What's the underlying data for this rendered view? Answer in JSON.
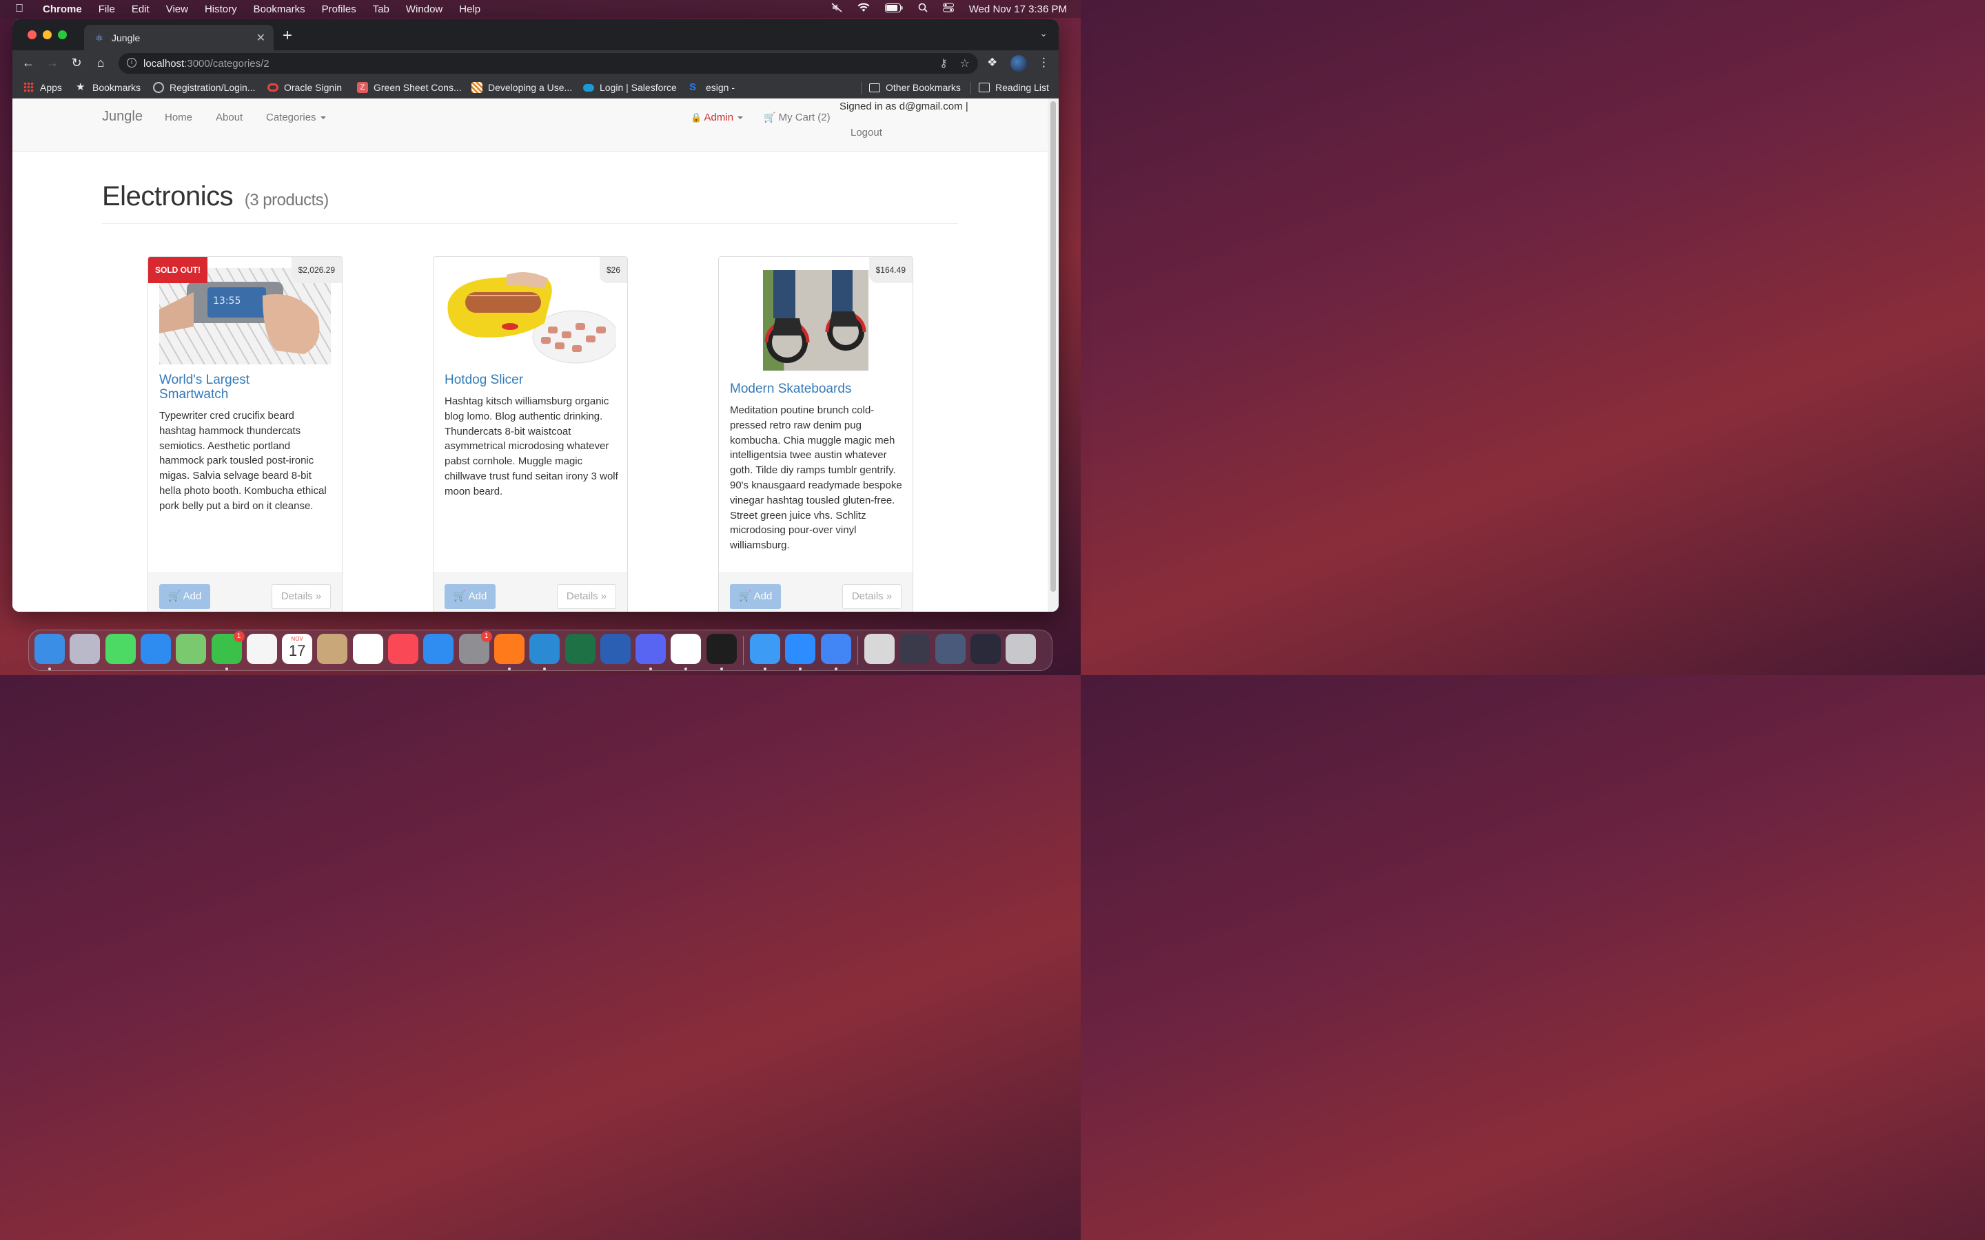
{
  "menubar": {
    "app_name": "Chrome",
    "items": [
      "File",
      "Edit",
      "View",
      "History",
      "Bookmarks",
      "Profiles",
      "Tab",
      "Window",
      "Help"
    ],
    "clock": "Wed Nov 17  3:36 PM"
  },
  "browser": {
    "tab_title": "Jungle",
    "url_host": "localhost",
    "url_path": ":3000/categories/2",
    "bookmarks": [
      {
        "label": "Apps",
        "icon": "apps-grid-icon",
        "color": "#e8453c"
      },
      {
        "label": "Bookmarks",
        "icon": "star-icon",
        "color": "#e8eaed"
      },
      {
        "label": "Registration/Login...",
        "icon": "globe-icon",
        "color": "#bdc1c6"
      },
      {
        "label": "Oracle Signin",
        "icon": "oracle-icon",
        "color": "#e8453c"
      },
      {
        "label": "Green Sheet Cons...",
        "icon": "z-icon",
        "color": "#e05d5d"
      },
      {
        "label": "Developing a Use...",
        "icon": "tiger-icon",
        "color": "#e08a2a"
      },
      {
        "label": "Login | Salesforce",
        "icon": "salesforce-icon",
        "color": "#1a9bd7"
      },
      {
        "label": "esign -",
        "icon": "s-icon",
        "color": "#2b7de9"
      }
    ],
    "other_bookmarks": "Other Bookmarks",
    "reading_list": "Reading List"
  },
  "navbar": {
    "brand": "Jungle",
    "home": "Home",
    "about": "About",
    "categories": "Categories",
    "admin": "Admin",
    "cart": "My Cart (2)",
    "signed_in": "Signed in as d@gmail.com |",
    "logout": "Logout"
  },
  "category": {
    "title": "Electronics",
    "count": "(3 products)"
  },
  "products": [
    {
      "name": "World's Largest Smartwatch",
      "price": "$2,026.29",
      "sold_out": "SOLD OUT!",
      "description": "Typewriter cred crucifix beard hashtag hammock thundercats semiotics. Aesthetic portland hammock park tousled post-ironic migas. Salvia selvage beard 8-bit hella photo booth. Kombucha ethical pork belly put a bird on it cleanse.",
      "add": "Add",
      "details": "Details »"
    },
    {
      "name": "Hotdog Slicer",
      "price": "$26",
      "description": "Hashtag kitsch williamsburg organic blog lomo. Blog authentic drinking. Thundercats 8-bit waistcoat asymmetrical microdosing whatever pabst cornhole. Muggle magic chillwave trust fund seitan irony 3 wolf moon beard.",
      "add": "Add",
      "details": "Details »"
    },
    {
      "name": "Modern Skateboards",
      "price": "$164.49",
      "description": "Meditation poutine brunch cold-pressed retro raw denim pug kombucha. Chia muggle magic meh intelligentsia twee austin whatever goth. Tilde diy ramps tumblr gentrify. 90's knausgaard readymade bespoke vinegar hashtag tousled gluten-free. Street green juice vhs. Schlitz microdosing pour-over vinyl williamsburg.",
      "add": "Add",
      "details": "Details »"
    }
  ],
  "dock": {
    "apps": [
      {
        "name": "finder-icon",
        "color": "#3a8ee6"
      },
      {
        "name": "launchpad-icon",
        "color": "#b9b9c9"
      },
      {
        "name": "messages-icon",
        "color": "#4cd964"
      },
      {
        "name": "mail-icon",
        "color": "#2e8bf0"
      },
      {
        "name": "maps-icon",
        "color": "#7bc96f"
      },
      {
        "name": "facetime-icon",
        "color": "#3bc14a"
      },
      {
        "name": "photos-icon",
        "color": "#f5f5f5"
      },
      {
        "name": "calendar-icon",
        "color": "#ffffff"
      },
      {
        "name": "contacts-icon",
        "color": "#c9a779"
      },
      {
        "name": "reminders-icon",
        "color": "#ffffff"
      },
      {
        "name": "music-icon",
        "color": "#fa4856"
      },
      {
        "name": "app-store-icon",
        "color": "#2f8cf0"
      },
      {
        "name": "system-preferences-icon",
        "color": "#8e8e93"
      },
      {
        "name": "firefox-icon",
        "color": "#ff7a1a"
      },
      {
        "name": "vscode-icon",
        "color": "#2a8ad4"
      },
      {
        "name": "excel-icon",
        "color": "#1e7145"
      },
      {
        "name": "word-icon",
        "color": "#2b5fb4"
      },
      {
        "name": "discord-icon",
        "color": "#5865f2"
      },
      {
        "name": "slack-icon",
        "color": "#ffffff"
      },
      {
        "name": "terminal-icon",
        "color": "#1e1e1e"
      },
      {
        "name": "safari-icon",
        "color": "#3b9bf5"
      },
      {
        "name": "zoom-icon",
        "color": "#2d8cff"
      },
      {
        "name": "chrome-icon",
        "color": "#4285f4"
      },
      {
        "name": "recent-window-1-icon",
        "color": "#d8d8d8"
      },
      {
        "name": "recent-window-2-icon",
        "color": "#3a3a4a"
      },
      {
        "name": "recent-window-3-icon",
        "color": "#4a5a7a"
      },
      {
        "name": "recent-window-4-icon",
        "color": "#2a2a3a"
      },
      {
        "name": "trash-icon",
        "color": "#c8c8cc"
      }
    ],
    "facetime_badge": "1",
    "sysprefs_badge": "1",
    "calendar_month": "NOV",
    "calendar_day": "17"
  }
}
